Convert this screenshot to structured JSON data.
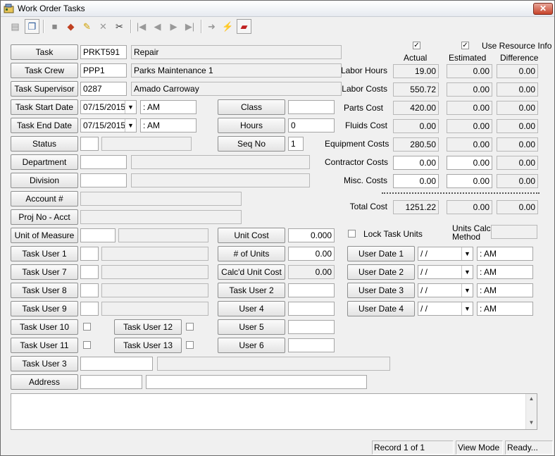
{
  "window": {
    "title": "Work Order Tasks",
    "close_label": "✕"
  },
  "toolbar": {
    "icons": [
      "properties-icon",
      "copy-icon",
      "save-icon",
      "book-icon",
      "edit-icon",
      "delete-icon",
      "cut-icon",
      "first-record-icon",
      "previous-record-icon",
      "next-record-icon",
      "last-record-icon",
      "go-icon",
      "lightning-icon",
      "eraser-icon"
    ]
  },
  "form": {
    "task": {
      "label": "Task",
      "code": "PRKT591",
      "desc": "Repair"
    },
    "task_crew": {
      "label": "Task Crew",
      "code": "PPP1",
      "desc": "Parks Maintenance 1"
    },
    "task_supervisor": {
      "label": "Task Supervisor",
      "code": "0287",
      "desc": "Amado Carroway"
    },
    "task_start_date": {
      "label": "Task Start Date",
      "date": "07/15/2015",
      "time": " :  AM"
    },
    "task_end_date": {
      "label": "Task End Date",
      "date": "07/15/2015",
      "time": " :  AM"
    },
    "status": {
      "label": "Status"
    },
    "department": {
      "label": "Department"
    },
    "division": {
      "label": "Division"
    },
    "account": {
      "label": "Account #"
    },
    "proj_no": {
      "label": "Proj No - Acct"
    },
    "unit_of_measure": {
      "label": "Unit of Measure"
    },
    "class": {
      "label": "Class",
      "value": ""
    },
    "hours": {
      "label": "Hours",
      "value": "0"
    },
    "seq_no": {
      "label": "Seq No",
      "value": "1"
    },
    "unit_cost": {
      "label": "Unit Cost",
      "value": "0.000"
    },
    "num_units": {
      "label": "# of Units",
      "value": "0.00"
    },
    "calcd_unit_cost": {
      "label": "Calc'd Unit Cost",
      "value": "0.00"
    },
    "task_user_1": {
      "label": "Task User 1"
    },
    "task_user_7": {
      "label": "Task User 7"
    },
    "task_user_8": {
      "label": "Task User 8"
    },
    "task_user_9": {
      "label": "Task User 9"
    },
    "task_user_10": {
      "label": "Task User 10"
    },
    "task_user_11": {
      "label": "Task User 11"
    },
    "task_user_12": {
      "label": "Task User 12"
    },
    "task_user_13": {
      "label": "Task User 13"
    },
    "task_user_2": {
      "label": "Task User 2"
    },
    "user_4": {
      "label": "User 4"
    },
    "user_5": {
      "label": "User 5"
    },
    "user_6": {
      "label": "User 6"
    },
    "task_user_3": {
      "label": "Task User 3"
    },
    "address": {
      "label": "Address"
    },
    "lock_task_units": {
      "label": "Lock Task Units"
    },
    "units_calc_method": {
      "label_line1": "Units Calc",
      "label_line2": "Method"
    },
    "user_dates": [
      {
        "label": "User Date 1",
        "date": " / /",
        "time": " :  AM"
      },
      {
        "label": "User Date 2",
        "date": " / /",
        "time": " :  AM"
      },
      {
        "label": "User Date 3",
        "date": " / /",
        "time": " :  AM"
      },
      {
        "label": "User Date 4",
        "date": " / /",
        "time": " :  AM"
      }
    ]
  },
  "costs": {
    "use_resource_info_label": "Use Resource Info",
    "headers": {
      "actual": "Actual",
      "estimated": "Estimated",
      "difference": "Difference"
    },
    "rows": [
      {
        "label": "Labor Hours",
        "actual": "19.00",
        "estimated": "0.00",
        "difference": "0.00"
      },
      {
        "label": "Labor Costs",
        "actual": "550.72",
        "estimated": "0.00",
        "difference": "0.00"
      },
      {
        "label": "Parts Cost",
        "actual": "420.00",
        "estimated": "0.00",
        "difference": "0.00"
      },
      {
        "label": "Fluids Cost",
        "actual": "0.00",
        "estimated": "0.00",
        "difference": "0.00"
      },
      {
        "label": "Equipment Costs",
        "actual": "280.50",
        "estimated": "0.00",
        "difference": "0.00"
      },
      {
        "label": "Contractor Costs",
        "actual": "0.00",
        "estimated": "0.00",
        "difference": "0.00"
      },
      {
        "label": "Misc. Costs",
        "actual": "0.00",
        "estimated": "0.00",
        "difference": "0.00"
      }
    ],
    "total": {
      "label": "Total Cost",
      "actual": "1251.22",
      "estimated": "0.00",
      "difference": "0.00"
    }
  },
  "statusbar": {
    "record": "Record 1 of 1",
    "mode": "View Mode",
    "state": "Ready..."
  }
}
